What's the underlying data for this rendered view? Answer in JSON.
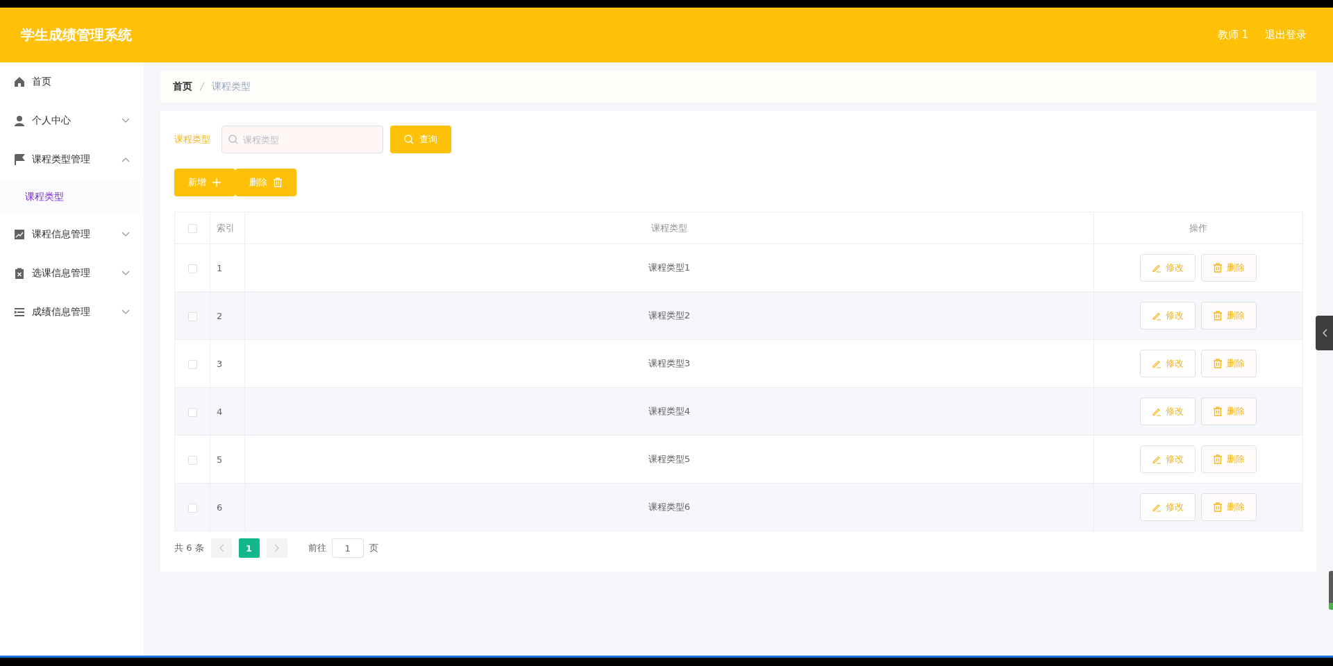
{
  "header": {
    "title": "学生成绩管理系统",
    "user": "教师 1",
    "logout": "退出登录"
  },
  "sidebar": {
    "items": [
      {
        "label": "首页"
      },
      {
        "label": "个人中心",
        "expanded": false
      },
      {
        "label": "课程类型管理",
        "expanded": true,
        "children": [
          {
            "label": "课程类型",
            "selected": true
          }
        ]
      },
      {
        "label": "课程信息管理",
        "expanded": false
      },
      {
        "label": "选课信息管理",
        "expanded": false
      },
      {
        "label": "成绩信息管理",
        "expanded": false
      }
    ]
  },
  "breadcrumb": [
    "首页",
    "课程类型"
  ],
  "search": {
    "label": "课程类型",
    "placeholder": "课程类型",
    "button": "查询"
  },
  "toolbar": [
    {
      "label": "新增",
      "kind": "add"
    },
    {
      "label": "删除",
      "kind": "delete"
    }
  ],
  "table": {
    "select_all": {
      "checked": false
    },
    "columns": [
      "索引",
      "课程类型",
      "操作"
    ],
    "rows": [
      {
        "checked": false,
        "index": "1",
        "type": "课程类型1",
        "actions": [
          {
            "label": "修改",
            "kind": "edit"
          },
          {
            "label": "删除",
            "kind": "delete"
          }
        ]
      },
      {
        "checked": false,
        "index": "2",
        "type": "课程类型2",
        "actions": [
          {
            "label": "修改",
            "kind": "edit"
          },
          {
            "label": "删除",
            "kind": "delete"
          }
        ]
      },
      {
        "checked": false,
        "index": "3",
        "type": "课程类型3",
        "actions": [
          {
            "label": "修改",
            "kind": "edit"
          },
          {
            "label": "删除",
            "kind": "delete"
          }
        ]
      },
      {
        "checked": false,
        "index": "4",
        "type": "课程类型4",
        "actions": [
          {
            "label": "修改",
            "kind": "edit"
          },
          {
            "label": "删除",
            "kind": "delete"
          }
        ]
      },
      {
        "checked": false,
        "index": "5",
        "type": "课程类型5",
        "actions": [
          {
            "label": "修改",
            "kind": "edit"
          },
          {
            "label": "删除",
            "kind": "delete"
          }
        ]
      },
      {
        "checked": false,
        "index": "6",
        "type": "课程类型6",
        "actions": [
          {
            "label": "修改",
            "kind": "edit"
          },
          {
            "label": "删除",
            "kind": "delete"
          }
        ]
      }
    ]
  },
  "pagination": {
    "total": "共 6 条",
    "pages": [
      {
        "label": "1",
        "selected": true
      }
    ],
    "goto_label": "前往",
    "goto_value": "1",
    "goto_suffix": "页"
  }
}
